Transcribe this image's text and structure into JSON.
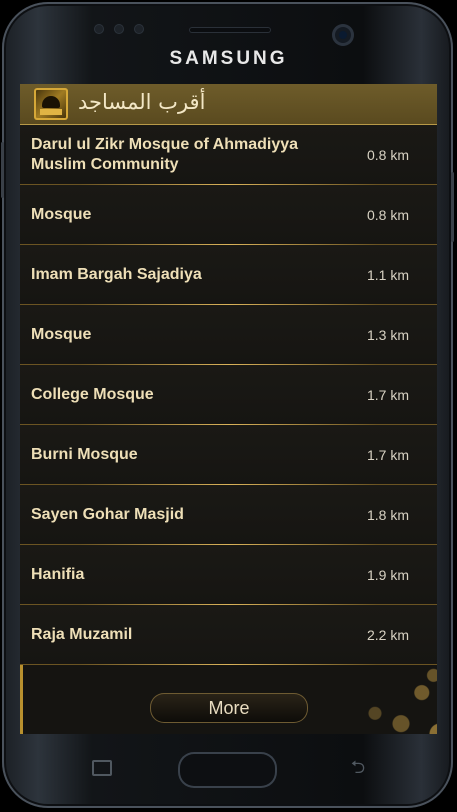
{
  "device": {
    "brand": "SAMSUNG"
  },
  "header": {
    "title": "أقرب المساجد",
    "icon": "mosque-icon"
  },
  "mosques": [
    {
      "name": "Darul ul Zikr Mosque of Ahmadiyya Muslim Community",
      "distance": "0.8 km"
    },
    {
      "name": "Mosque",
      "distance": "0.8 km"
    },
    {
      "name": "Imam Bargah Sajadiya",
      "distance": "1.1 km"
    },
    {
      "name": "Mosque",
      "distance": "1.3 km"
    },
    {
      "name": "College Mosque",
      "distance": "1.7 km"
    },
    {
      "name": "Burni Mosque",
      "distance": "1.7 km"
    },
    {
      "name": "Sayen Gohar Masjid",
      "distance": "1.8 km"
    },
    {
      "name": "Hanifia",
      "distance": "1.9 km"
    },
    {
      "name": "Raja Muzamil",
      "distance": "2.2 km"
    }
  ],
  "footer": {
    "more_label": "More"
  },
  "nav": {
    "recent": "recent-apps-icon",
    "home": "home-button",
    "back": "back-icon"
  },
  "colors": {
    "accent": "#c9a046",
    "header_bg": "#5e4d22",
    "row_text": "#eedfb7"
  }
}
